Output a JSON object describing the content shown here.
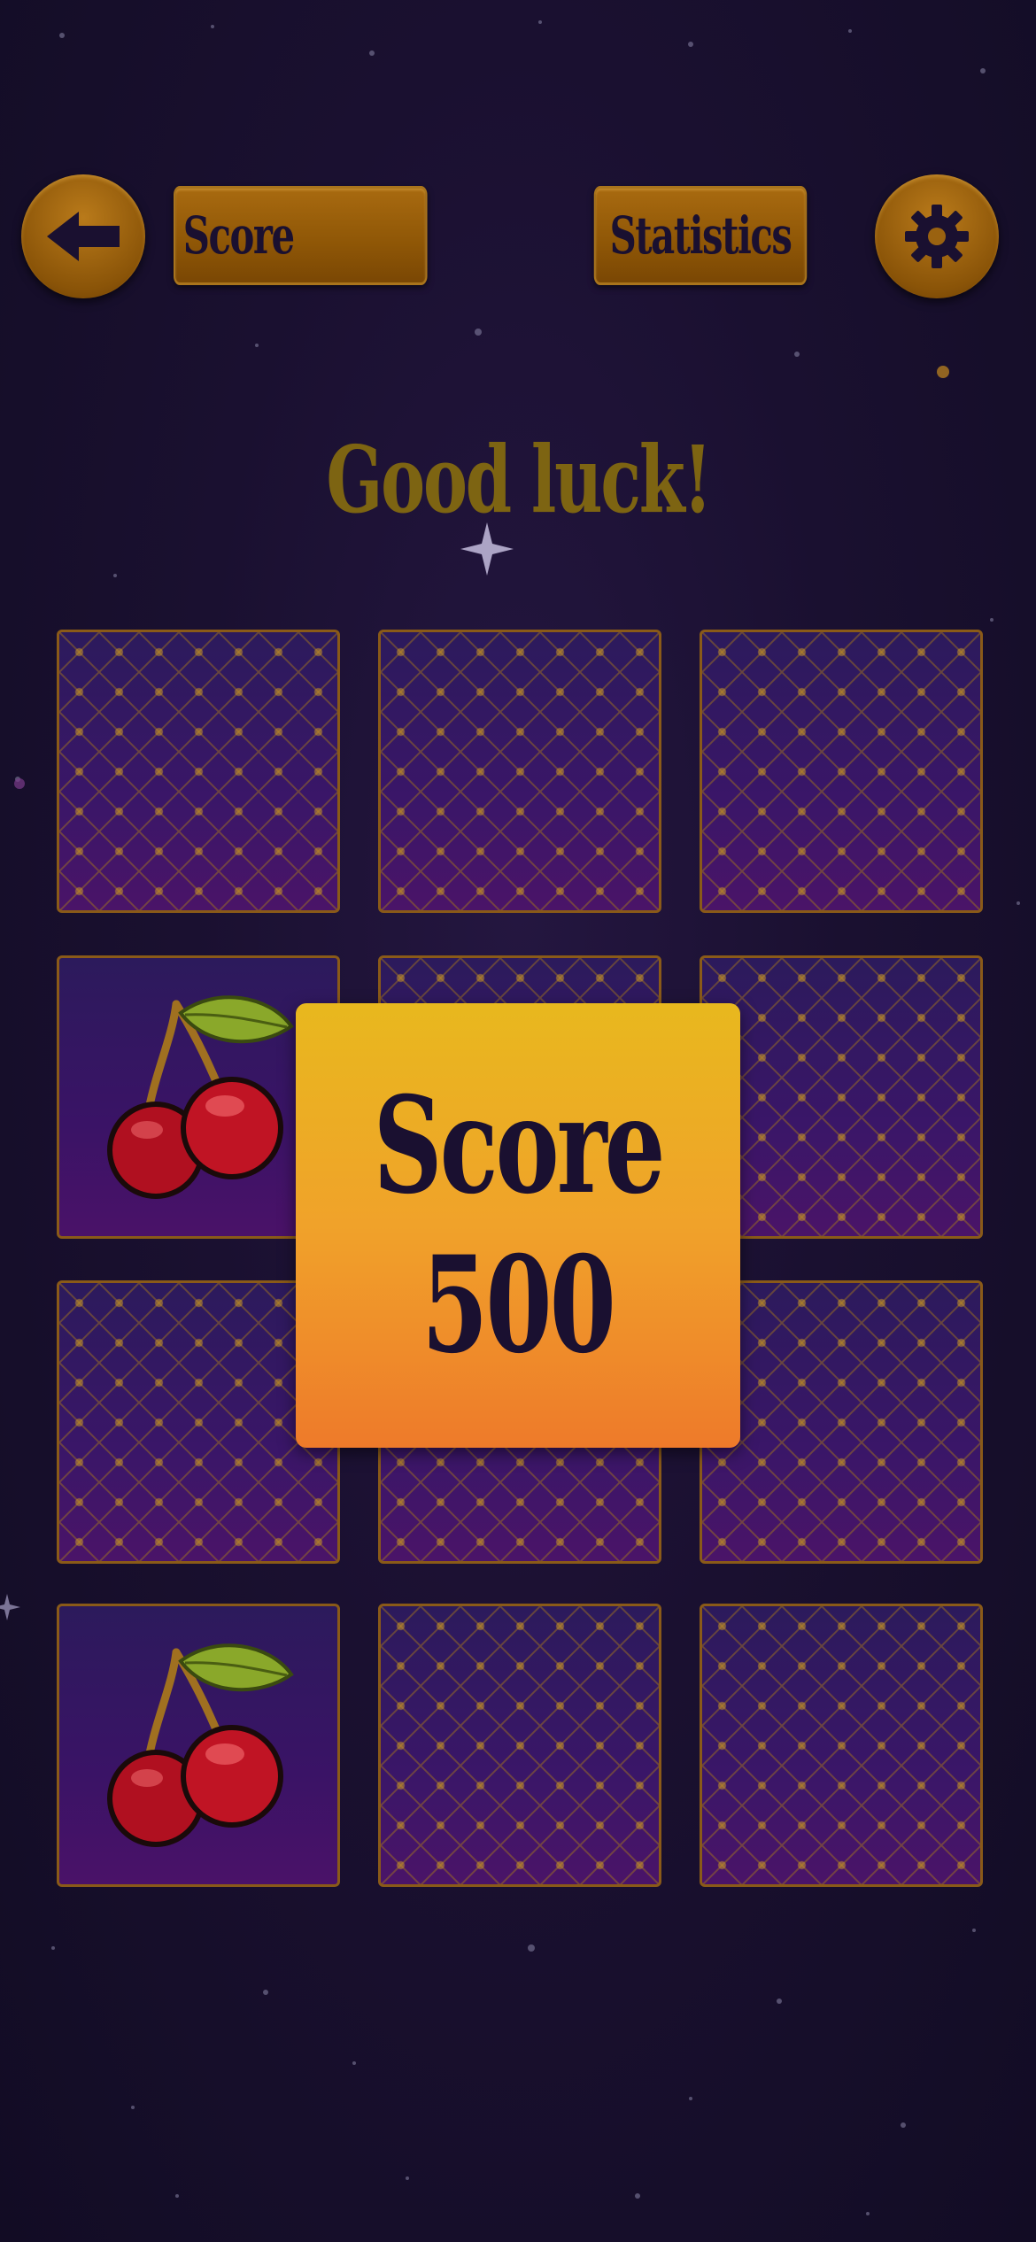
{
  "header": {
    "back_icon": "arrow-left-icon",
    "score_label": "Score",
    "statistics_label": "Statistics",
    "settings_icon": "gear-icon"
  },
  "title": "Good luck!",
  "grid": {
    "rows": 4,
    "cols": 3,
    "cards": [
      {
        "state": "back"
      },
      {
        "state": "back"
      },
      {
        "state": "back"
      },
      {
        "state": "front",
        "symbol": "cherries"
      },
      {
        "state": "back"
      },
      {
        "state": "back"
      },
      {
        "state": "back"
      },
      {
        "state": "back"
      },
      {
        "state": "back"
      },
      {
        "state": "front",
        "symbol": "cherries"
      },
      {
        "state": "back"
      },
      {
        "state": "back"
      }
    ]
  },
  "score_popup": {
    "label": "Score",
    "value": "500"
  },
  "colors": {
    "background": "#1a1030",
    "gold": "#8e5606",
    "title": "#7d6412",
    "popup_top": "#e8b81e",
    "popup_bottom": "#ee7a2a",
    "card_border": "#8a5a18"
  }
}
